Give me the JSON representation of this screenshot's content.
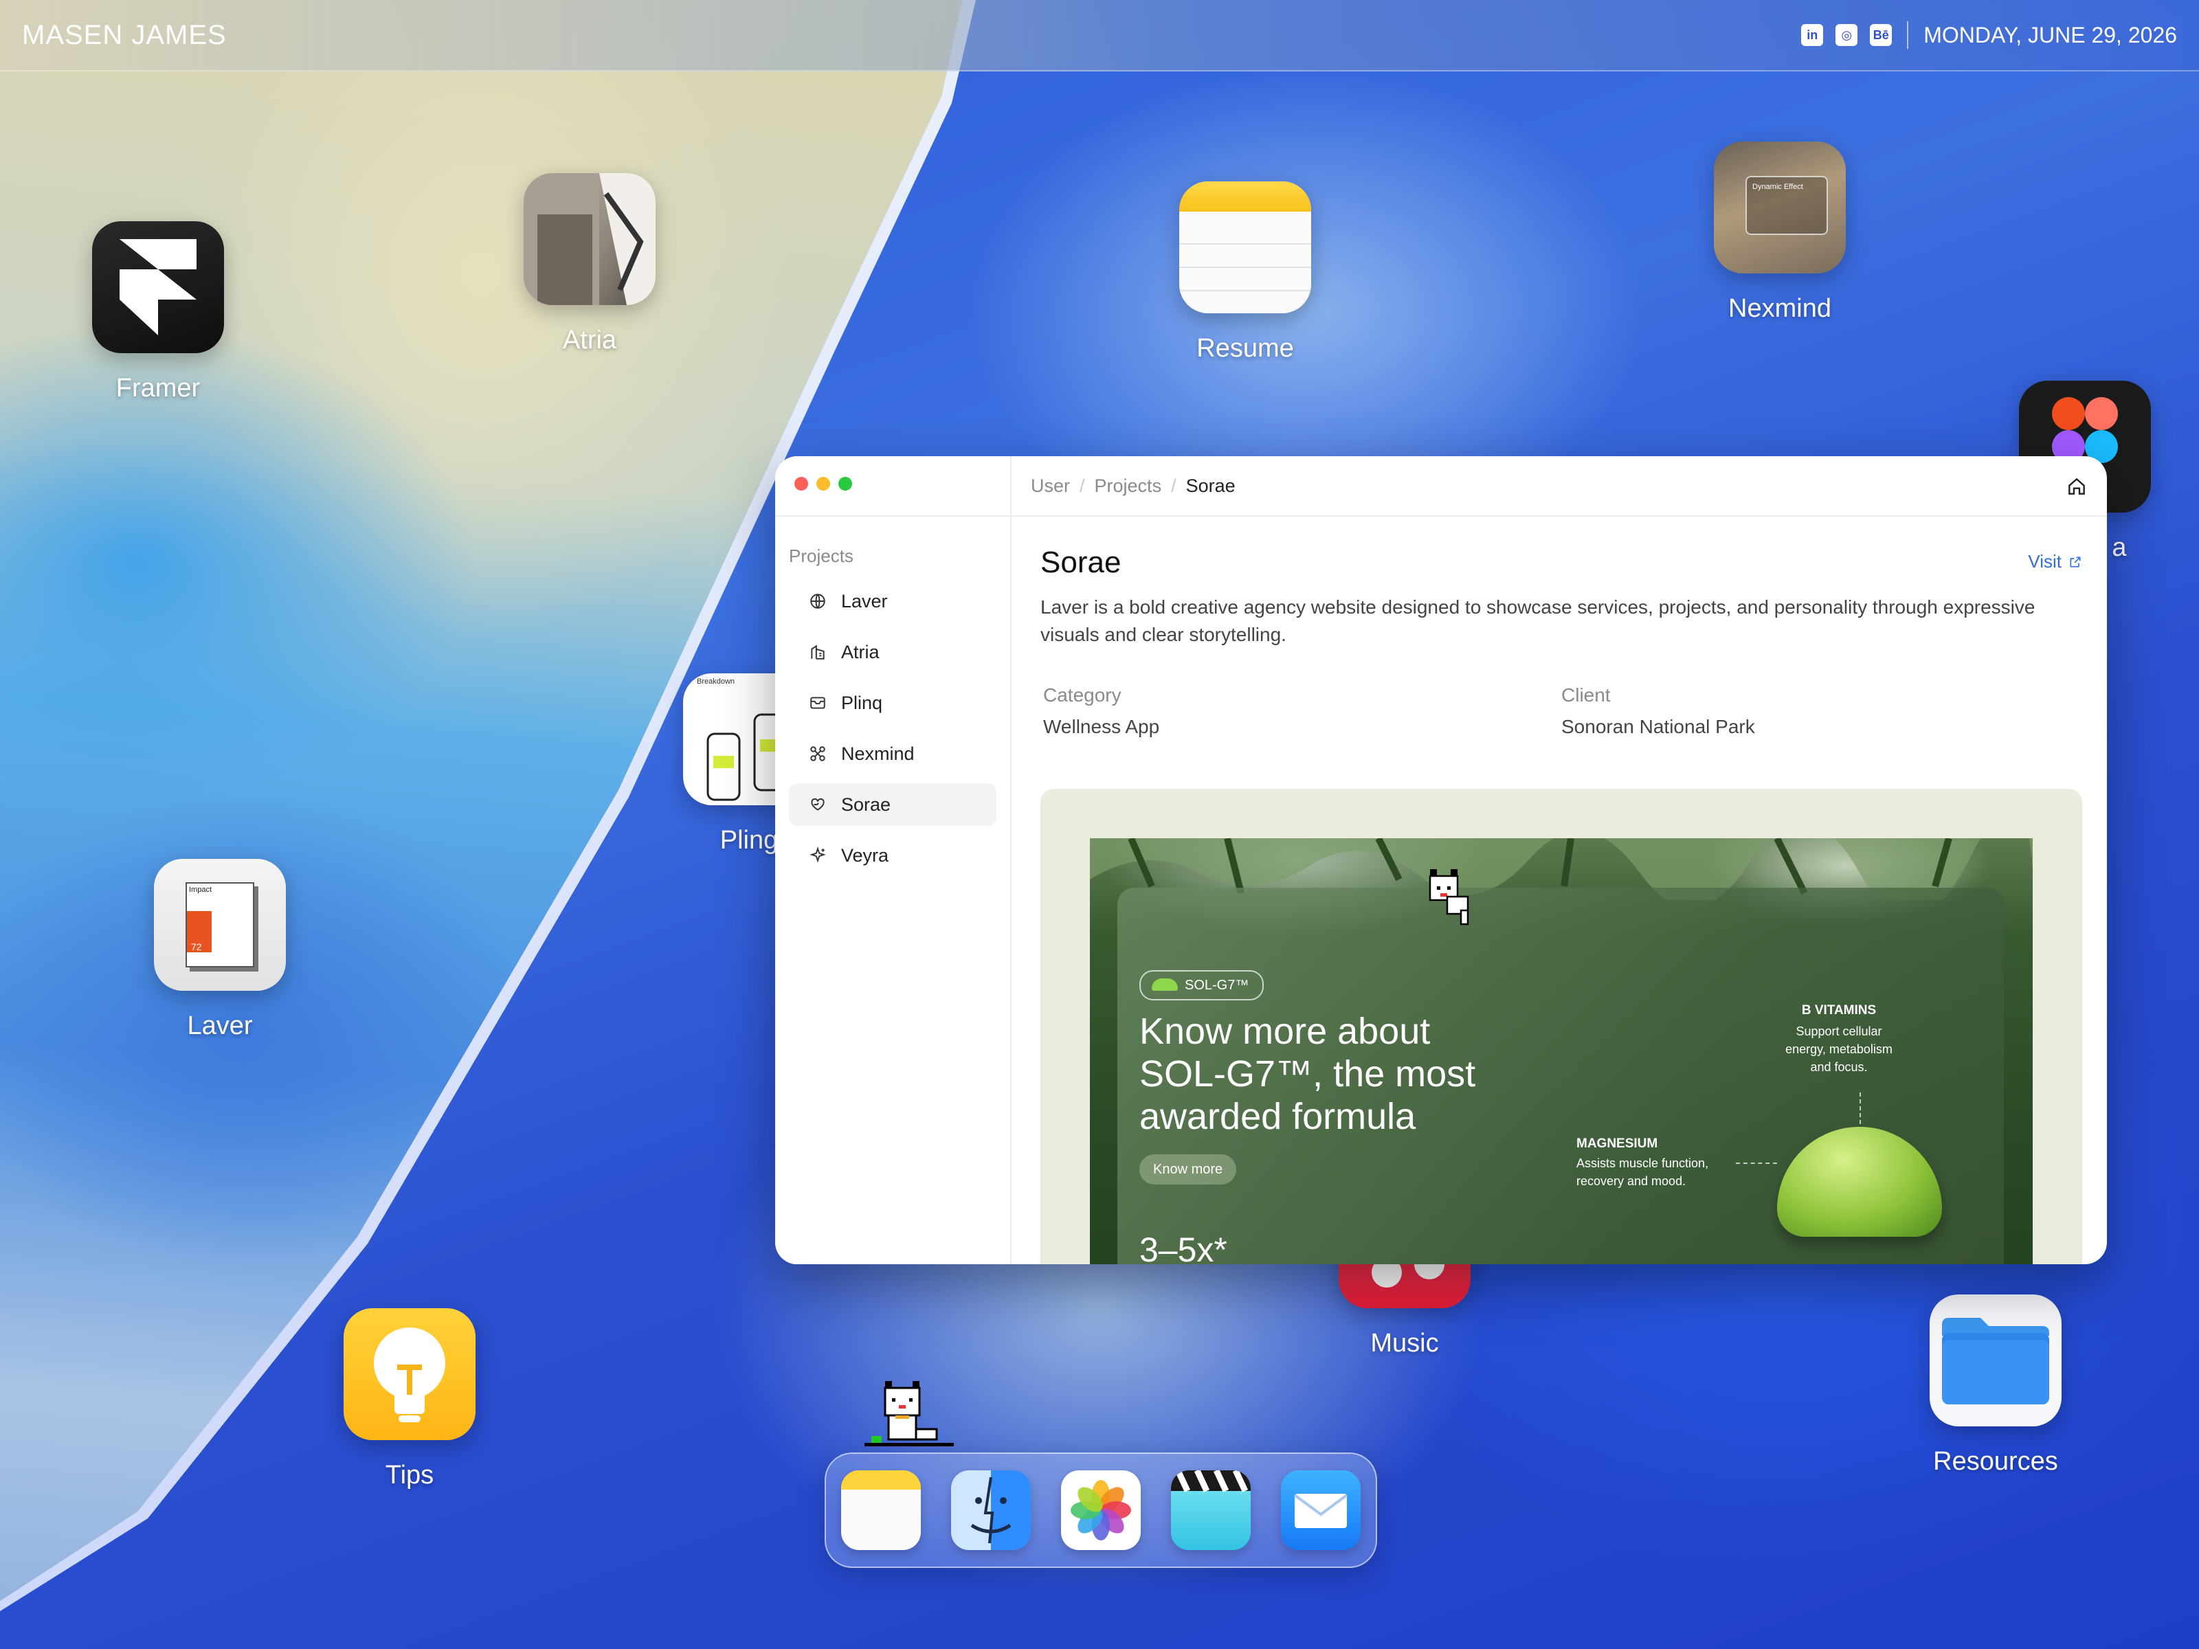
{
  "menubar": {
    "owner": "MASEN JAMES",
    "date": "MONDAY, JUNE 29, 2026",
    "social": [
      {
        "icon": "linkedin-icon",
        "glyph": "in"
      },
      {
        "icon": "instagram-icon",
        "glyph": "◎"
      },
      {
        "icon": "behance-icon",
        "glyph": "Bē"
      }
    ]
  },
  "desktop": {
    "framer": "Framer",
    "atria": "Atria",
    "resume": "Resume",
    "nexmind": "Nexmind",
    "figma_partial": "a",
    "laver": "Laver",
    "pling": "Pling",
    "tips": "Tips",
    "music": "Music",
    "resources": "Resources",
    "nexmind_card_text": "Dynamic Effect",
    "pling_card_text": "Breakdown",
    "laver_card_title": "Impact",
    "laver_card_number": "72"
  },
  "dock": {
    "apps": [
      "notes-app",
      "finder-app",
      "photos-app",
      "clips-app",
      "mail-app"
    ]
  },
  "window": {
    "breadcrumb": [
      "User",
      "Projects",
      "Sorae"
    ],
    "sidebar": {
      "title": "Projects",
      "items": [
        {
          "label": "Laver",
          "icon": "globe-icon"
        },
        {
          "label": "Atria",
          "icon": "building-icon"
        },
        {
          "label": "Plinq",
          "icon": "inbox-icon"
        },
        {
          "label": "Nexmind",
          "icon": "network-icon"
        },
        {
          "label": "Sorae",
          "icon": "heart-hand-icon",
          "active": true
        },
        {
          "label": "Veyra",
          "icon": "sparkle-icon"
        }
      ]
    },
    "project": {
      "title": "Sorae",
      "visit_label": "Visit",
      "description": "Laver is a bold creative agency website designed to showcase services, projects, and personality through expressive visuals and clear storytelling.",
      "category_label": "Category",
      "category_value": "Wellness App",
      "client_label": "Client",
      "client_value": "Sonoran National Park"
    },
    "preview": {
      "badge": "SOL-G7™",
      "headline": "Know more about SOL-G7™, the most awarded formula",
      "cta": "Know more",
      "stat": "3–5x*",
      "vitamins_title": "B VITAMINS",
      "vitamins_text": "Support cellular energy, metabolism and focus.",
      "magnesium_title": "MAGNESIUM",
      "magnesium_text": "Assists muscle function, recovery and mood."
    }
  },
  "colors": {
    "accent_link": "#2f6fd8",
    "traffic_red": "#ff5f57",
    "traffic_yellow": "#febc2e",
    "traffic_green": "#28c840"
  }
}
